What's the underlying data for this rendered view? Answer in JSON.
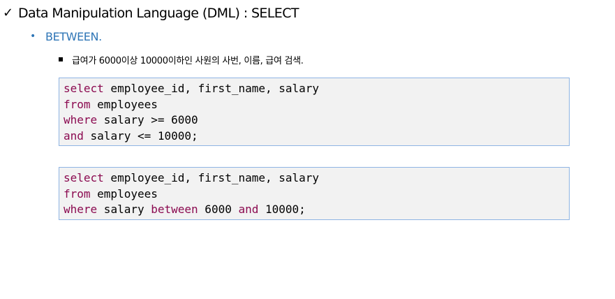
{
  "header": {
    "check_icon": "check-icon",
    "title": "Data Manipulation Language (DML) : SELECT"
  },
  "bullet": {
    "dot": "•",
    "label": "BETWEEN."
  },
  "subbullet": {
    "label": "급여가 6000이상 10000이하인 사원의 사번, 이름, 급여 검색."
  },
  "code_blocks": [
    {
      "lines": [
        [
          {
            "t": "select",
            "kw": true
          },
          {
            "t": " employee_id, first_name, salary",
            "kw": false
          }
        ],
        [
          {
            "t": "from",
            "kw": true
          },
          {
            "t": " employees",
            "kw": false
          }
        ],
        [
          {
            "t": "where",
            "kw": true
          },
          {
            "t": " salary >= 6000",
            "kw": false
          }
        ],
        [
          {
            "t": "and",
            "kw": true
          },
          {
            "t": " salary <= 10000;",
            "kw": false
          }
        ]
      ]
    },
    {
      "lines": [
        [
          {
            "t": "select",
            "kw": true
          },
          {
            "t": " employee_id, first_name, salary",
            "kw": false
          }
        ],
        [
          {
            "t": "from",
            "kw": true
          },
          {
            "t": " employees",
            "kw": false
          }
        ],
        [
          {
            "t": "where",
            "kw": true
          },
          {
            "t": " salary ",
            "kw": false
          },
          {
            "t": "between",
            "kw": true
          },
          {
            "t": " 6000 ",
            "kw": false
          },
          {
            "t": "and",
            "kw": true
          },
          {
            "t": " 10000;",
            "kw": false
          }
        ]
      ]
    }
  ],
  "colors": {
    "keyword": "#8B0A50",
    "bullet": "#2E75B6",
    "code_background": "#F2F2F2",
    "code_border": "#8EB4E3"
  }
}
